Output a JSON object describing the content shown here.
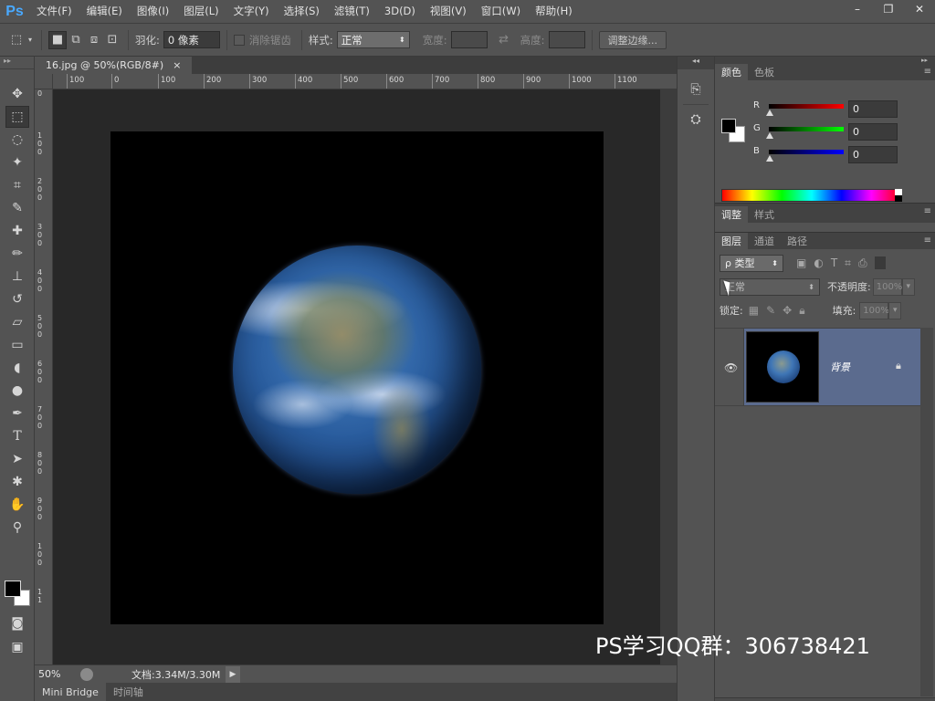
{
  "app": {
    "logo": "Ps"
  },
  "menu": [
    "文件(F)",
    "编辑(E)",
    "图像(I)",
    "图层(L)",
    "文字(Y)",
    "选择(S)",
    "滤镜(T)",
    "3D(D)",
    "视图(V)",
    "窗口(W)",
    "帮助(H)"
  ],
  "window_controls": {
    "minimize": "–",
    "restore": "❐",
    "close": "✕"
  },
  "options": {
    "feather_label": "羽化:",
    "feather_value": "0 像素",
    "antialias_label": "消除锯齿",
    "style_label": "样式:",
    "style_value": "正常",
    "width_label": "宽度:",
    "height_label": "高度:",
    "refine_edge_button": "调整边缘..."
  },
  "document": {
    "tab_title": "16.jpg @ 50%(RGB/8#)",
    "tab_close": "×",
    "ruler_h": [
      "100",
      "0",
      "100",
      "200",
      "300",
      "400",
      "500",
      "600",
      "700",
      "800",
      "900",
      "1000",
      "1100"
    ],
    "ruler_v": [
      "0",
      "1 0 0",
      "2 0 0",
      "3 0 0",
      "4 0 0",
      "5 0 0",
      "6 0 0",
      "7 0 0",
      "8 0 0",
      "9 0 0",
      "1 0 0",
      "1 1"
    ],
    "zoom": "50%",
    "doc_info": "文档:3.34M/3.30M",
    "status_arrow": "▶"
  },
  "bottom_tabs": [
    "Mini Bridge",
    "时间轴"
  ],
  "color_panel": {
    "tabs": [
      "颜色",
      "色板"
    ],
    "channels": [
      {
        "label": "R",
        "value": "0",
        "gradient": "linear-gradient(to right,#000,#ff0000)"
      },
      {
        "label": "G",
        "value": "0",
        "gradient": "linear-gradient(to right,#000,#00ff00)"
      },
      {
        "label": "B",
        "value": "0",
        "gradient": "linear-gradient(to right,#000,#0000ff)"
      }
    ]
  },
  "adjust_panel": {
    "tabs": [
      "调整",
      "样式"
    ]
  },
  "layers_panel": {
    "tabs": [
      "图层",
      "通道",
      "路径"
    ],
    "filter_kind": "ρ 类型",
    "blend_mode": "正常",
    "opacity_label": "不透明度:",
    "opacity_value": "100%",
    "lock_label": "锁定:",
    "fill_label": "填充:",
    "fill_value": "100%",
    "layers": [
      {
        "name": "背景",
        "visible": true,
        "locked": true
      }
    ],
    "footer_icons": [
      "link-icon",
      "fx-icon",
      "mask-icon",
      "adjustment-icon",
      "folder-icon",
      "new-layer-icon",
      "trash-icon"
    ]
  },
  "watermark": "PS学习QQ群：306738421",
  "colors": {
    "ui_bg": "#535353",
    "canvas_bg": "#282828",
    "layer_selected": "#5b6b8e",
    "accent": "#49a9ff"
  }
}
